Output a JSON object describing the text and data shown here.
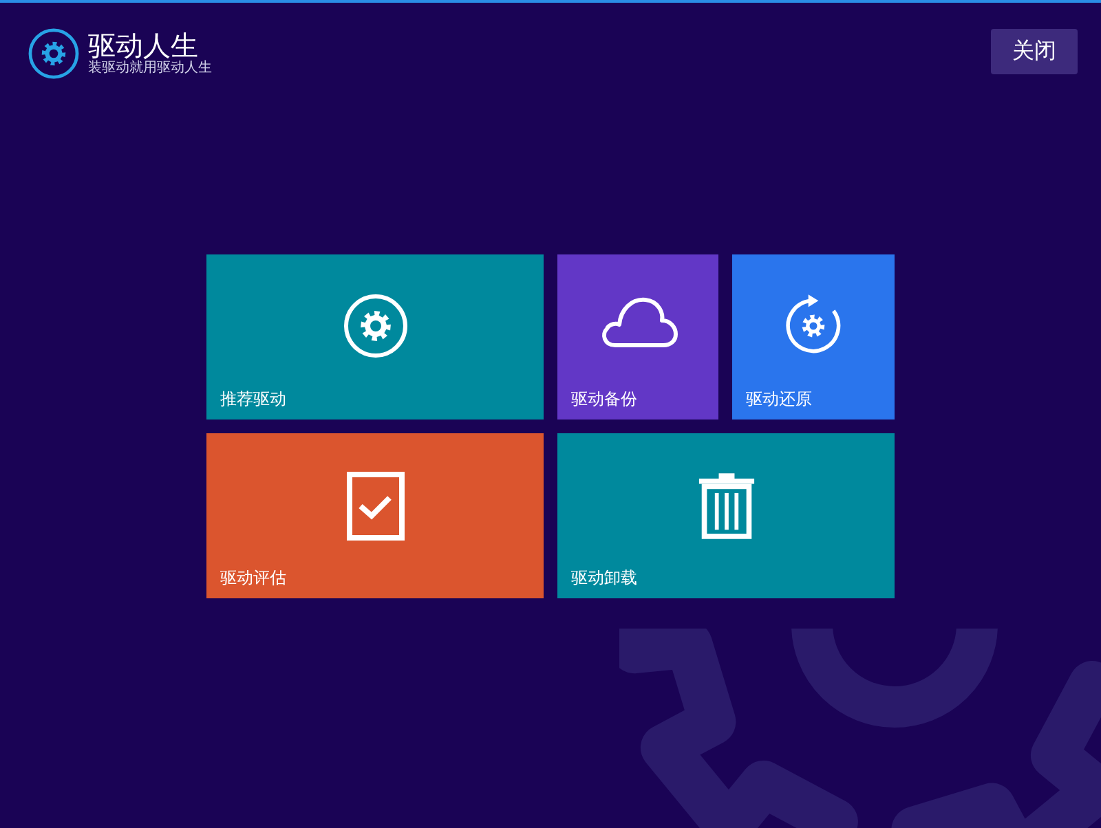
{
  "app": {
    "name": "驱动人生",
    "tagline": "装驱动就用驱动人生"
  },
  "close_button": {
    "label": "关闭"
  },
  "tiles": [
    {
      "label": "推荐驱动",
      "kind": "gear",
      "color": "#00899d"
    },
    {
      "label": "驱动备份",
      "kind": "cloud",
      "color": "#6237c6"
    },
    {
      "label": "驱动还原",
      "kind": "restore",
      "color": "#2a75ed"
    },
    {
      "label": "驱动评估",
      "kind": "check",
      "color": "#db552e"
    },
    {
      "label": "驱动卸载",
      "kind": "trash",
      "color": "#00899d"
    }
  ]
}
